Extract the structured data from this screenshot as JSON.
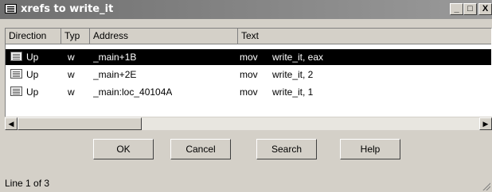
{
  "window": {
    "title": "xrefs to write_it"
  },
  "titlebar_buttons": {
    "minimize": "_",
    "maximize": "□",
    "close": "X"
  },
  "table": {
    "columns": [
      "Direction",
      "Typ",
      "Address",
      "Text"
    ],
    "rows": [
      {
        "direction": "Up",
        "type": "w",
        "address": "_main+1B",
        "mnemonic": "mov",
        "operands": "write_it, eax"
      },
      {
        "direction": "Up",
        "type": "w",
        "address": "_main+2E",
        "mnemonic": "mov",
        "operands": "write_it, 2"
      },
      {
        "direction": "Up",
        "type": "w",
        "address": "_main:loc_40104A",
        "mnemonic": "mov",
        "operands": "write_it, 1"
      }
    ],
    "selected_row": 0
  },
  "scrollbar": {
    "left_arrow": "◀",
    "right_arrow": "▶"
  },
  "buttons": {
    "ok": "OK",
    "cancel": "Cancel",
    "search": "Search",
    "help": "Help"
  },
  "status": "Line 1 of 3",
  "icons": {
    "title": "list-window-icon",
    "row": "xref-entry-icon"
  }
}
